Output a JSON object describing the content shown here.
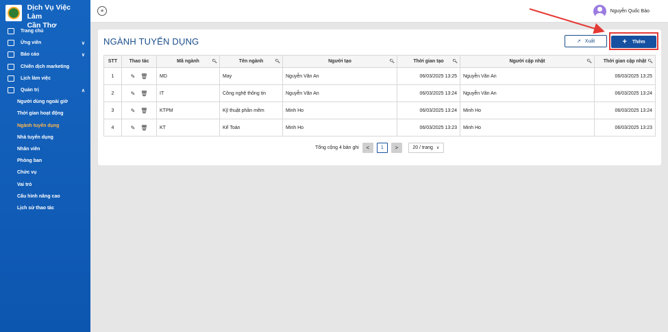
{
  "brand": {
    "title_line1": "Dịch Vụ Việc Làm",
    "title_line2": "Cần Thơ"
  },
  "menu": {
    "items": [
      {
        "label": "Trang chủ",
        "icon": "home-icon"
      },
      {
        "label": "Ứng viên",
        "icon": "candidate-icon",
        "chevron": "∨"
      },
      {
        "label": "Báo cáo",
        "icon": "report-icon",
        "chevron": "∨"
      },
      {
        "label": "Chiến dịch marketing",
        "icon": "campaign-icon"
      },
      {
        "label": "Lịch làm việc",
        "icon": "calendar-icon"
      },
      {
        "label": "Quản trị",
        "icon": "admin-icon",
        "chevron": "∧"
      }
    ],
    "subitems": [
      "Người dùng ngoài giờ",
      "Thời gian hoạt động",
      "Ngành tuyển dụng",
      "Nhà tuyển dụng",
      "Nhân viên",
      "Phòng ban",
      "Chức vụ",
      "Vai trò",
      "Cấu hình nâng cao",
      "Lịch sử thao tác"
    ],
    "active_subitem": "Ngành tuyển dụng"
  },
  "header": {
    "menu_toggle": "≡",
    "user_name": "Nguyễn Quốc Bảo"
  },
  "page": {
    "title": "NGÀNH TUYỂN DỤNG",
    "export_label": "Xuất",
    "export_icon": "↗",
    "add_label": "Thêm",
    "add_icon": "+"
  },
  "table": {
    "columns": [
      "STT",
      "Thao tác",
      "Mã ngành",
      "Tên ngành",
      "Người tạo",
      "Thời gian tạo",
      "Người cập nhật",
      "Thời gian cập nhật"
    ],
    "rows": [
      {
        "stt": "1",
        "code": "MD",
        "name": "May",
        "creator": "Nguyễn Văn An",
        "created_at": "06/03/2025 13:25",
        "updater": "Nguyễn Văn An",
        "updated_at": "06/03/2025 13:25"
      },
      {
        "stt": "2",
        "code": "IT",
        "name": "Công nghệ thông tin",
        "creator": "Nguyễn Văn An",
        "created_at": "06/03/2025 13:24",
        "updater": "Nguyễn Văn An",
        "updated_at": "06/03/2025 13:24"
      },
      {
        "stt": "3",
        "code": "KTPM",
        "name": "Kỹ thuật phần mềm",
        "creator": "Minh Ho",
        "created_at": "06/03/2025 13:24",
        "updater": "Minh Ho",
        "updated_at": "06/03/2025 13:24"
      },
      {
        "stt": "4",
        "code": "KT",
        "name": "Kế Toán",
        "creator": "Minh Ho",
        "created_at": "06/03/2025 13:23",
        "updater": "Minh Ho",
        "updated_at": "06/03/2025 13:23"
      }
    ],
    "edit_icon": "✎",
    "delete_icon": "🗑"
  },
  "pagination": {
    "total_text": "Tổng cộng 4 bản ghi",
    "prev": "<",
    "current": "1",
    "next": ">",
    "page_size": "20 / trang",
    "page_size_caret": "∨"
  },
  "colors": {
    "primary": "#1650a0",
    "sidebar": "#1565c0",
    "active": "#ffb74d",
    "highlight": "#e53935"
  }
}
